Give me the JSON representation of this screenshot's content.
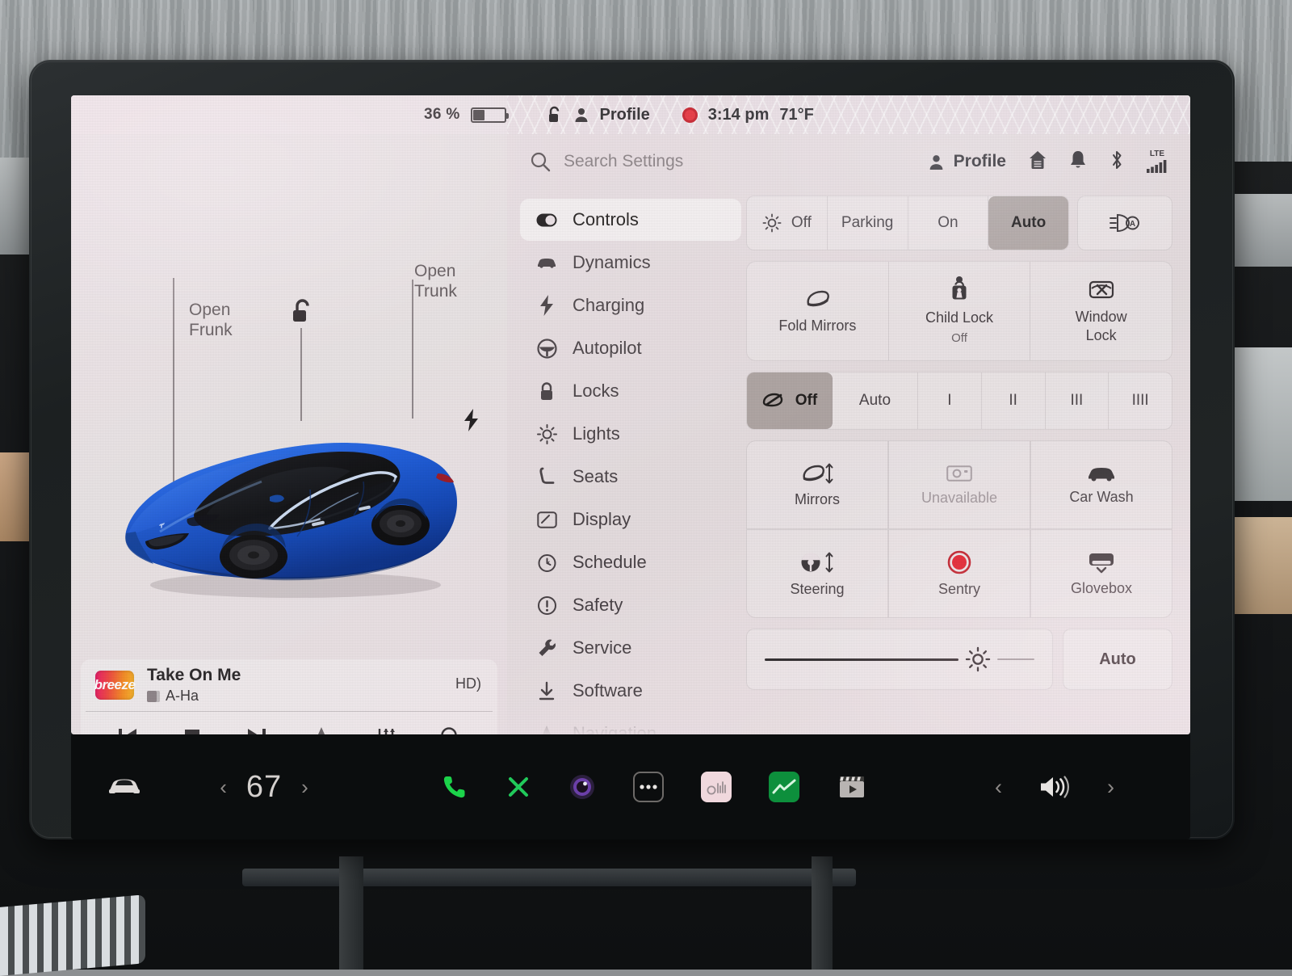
{
  "status_bar": {
    "battery_percent": "36 %",
    "battery_level": 36,
    "lock_icon": "unlock-icon",
    "profile_label": "Profile",
    "recording_icon": "sentry-record-icon",
    "time": "3:14 pm",
    "temperature": "71°F"
  },
  "car_view": {
    "frunk_label": "Open\nFrunk",
    "trunk_label": "Open\nTrunk",
    "frunk_line1": "Open",
    "frunk_line2": "Frunk",
    "trunk_line1": "Open",
    "trunk_line2": "Trunk",
    "unlock_icon": "unlock-icon",
    "charge_icon": "charge-bolt-icon",
    "car_color": "#1659d6",
    "roof_color": "#0c0c10"
  },
  "media": {
    "album_art_text": "breeze",
    "track_title": "Take On Me",
    "artist": "A-Ha",
    "quality_badge": "HD",
    "controls": [
      {
        "name": "previous-track-button",
        "glyph": "prev"
      },
      {
        "name": "stop-button",
        "glyph": "stop"
      },
      {
        "name": "next-track-button",
        "glyph": "next"
      },
      {
        "name": "favorite-button",
        "glyph": "star"
      },
      {
        "name": "equalizer-button",
        "glyph": "sliders"
      },
      {
        "name": "media-search-button",
        "glyph": "search"
      }
    ]
  },
  "settings": {
    "search": {
      "placeholder": "Search Settings"
    },
    "top_icons": {
      "profile_label": "Profile",
      "icons": [
        "home-icon",
        "bell-icon",
        "bluetooth-icon",
        "cellular-signal-icon"
      ],
      "network_label": "LTE"
    },
    "sidebar": {
      "items": [
        {
          "label": "Controls",
          "icon": "toggle-icon",
          "active": true
        },
        {
          "label": "Dynamics",
          "icon": "car-icon",
          "active": false
        },
        {
          "label": "Charging",
          "icon": "bolt-icon",
          "active": false
        },
        {
          "label": "Autopilot",
          "icon": "steering-icon",
          "active": false
        },
        {
          "label": "Locks",
          "icon": "lock-icon",
          "active": false
        },
        {
          "label": "Lights",
          "icon": "sun-icon",
          "active": false
        },
        {
          "label": "Seats",
          "icon": "seat-icon",
          "active": false
        },
        {
          "label": "Display",
          "icon": "display-icon",
          "active": false
        },
        {
          "label": "Schedule",
          "icon": "clock-icon",
          "active": false
        },
        {
          "label": "Safety",
          "icon": "warning-icon",
          "active": false
        },
        {
          "label": "Service",
          "icon": "wrench-icon",
          "active": false
        },
        {
          "label": "Software",
          "icon": "download-icon",
          "active": false
        },
        {
          "label": "Navigation",
          "icon": "navigation-icon",
          "active": false
        }
      ]
    },
    "headlights": {
      "options": [
        {
          "label": "Off",
          "icon": "headlight-off-icon",
          "selected": false
        },
        {
          "label": "Parking",
          "icon": "",
          "selected": false
        },
        {
          "label": "On",
          "icon": "",
          "selected": false
        },
        {
          "label": "Auto",
          "icon": "",
          "selected": true
        }
      ],
      "highbeam_icon": "auto-highbeam-icon"
    },
    "mirror_row": [
      {
        "label": "Fold Mirrors",
        "sub": "",
        "icon": "mirror-icon"
      },
      {
        "label": "Child Lock",
        "sub": "Off",
        "icon": "child-lock-icon"
      },
      {
        "label": "Window\nLock",
        "sub": "",
        "icon": "window-lock-icon",
        "line1": "Window",
        "line2": "Lock"
      }
    ],
    "wipers": {
      "options": [
        {
          "label": "Off",
          "icon": "wiper-icon",
          "selected": true
        },
        {
          "label": "Auto",
          "icon": "",
          "selected": false
        },
        {
          "label": "I",
          "icon": "",
          "selected": false
        },
        {
          "label": "II",
          "icon": "",
          "selected": false
        },
        {
          "label": "III",
          "icon": "",
          "selected": false
        },
        {
          "label": "IIII",
          "icon": "",
          "selected": false
        }
      ]
    },
    "quick_tiles": [
      {
        "label": "Mirrors",
        "icon": "mirror-adjust-icon",
        "disabled": false
      },
      {
        "label": "Unavailable",
        "icon": "camera-icon",
        "disabled": true
      },
      {
        "label": "Car Wash",
        "icon": "car-wash-icon",
        "disabled": false
      },
      {
        "label": "Steering",
        "icon": "steering-adjust-icon",
        "disabled": false
      },
      {
        "label": "Sentry",
        "icon": "sentry-icon",
        "disabled": false
      },
      {
        "label": "Glovebox",
        "icon": "glovebox-icon",
        "disabled": false
      }
    ],
    "brightness": {
      "icon": "brightness-icon",
      "value_percent": 72,
      "auto_label": "Auto"
    }
  },
  "taskbar": {
    "car_icon": "car-front-icon",
    "temperature": "67",
    "prev_icon": "chevron-left-icon",
    "next_icon": "chevron-right-icon",
    "apps": [
      {
        "name": "phone-app-icon",
        "color": "#1cd34a"
      },
      {
        "name": "bluetooth-app-icon",
        "color": "#21c95a"
      },
      {
        "name": "camera-app-icon",
        "color": "#7b4fb8"
      },
      {
        "name": "more-apps-icon",
        "color": "#e8e5e3"
      },
      {
        "name": "radio-app-icon",
        "color": "#f0d8dd"
      },
      {
        "name": "energy-app-icon",
        "color": "#0d8f3c"
      },
      {
        "name": "theater-app-icon",
        "color": "#b8b4b2"
      }
    ],
    "volume_icon": "volume-icon",
    "volume_prev_icon": "chevron-left-icon"
  }
}
